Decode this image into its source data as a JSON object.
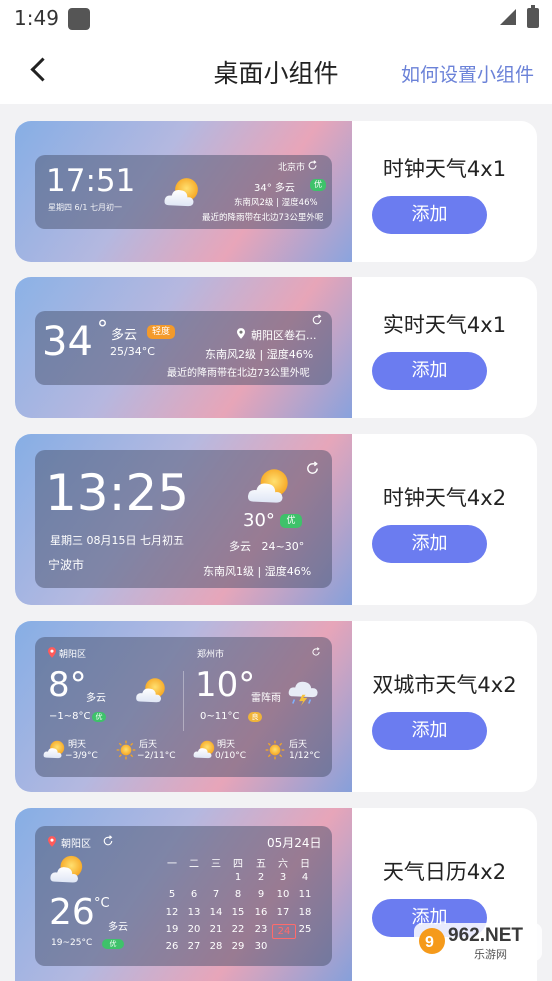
{
  "status": {
    "time": "1:49"
  },
  "header": {
    "title": "桌面小组件",
    "help_link": "如何设置小组件"
  },
  "add_label": "添加",
  "widgets": [
    {
      "name": "时钟天气4x1",
      "time": "17:51",
      "date": "星期四 6/1 七月初一",
      "city": "北京市",
      "temp_cond": "34° 多云",
      "aqi": "优",
      "wind_humidity": "东南风2级 | 湿度46%",
      "rain": "最近的降雨带在北边73公里外呢"
    },
    {
      "name": "实时天气4x1",
      "temp": "34",
      "deg": "°",
      "cond": "多云",
      "aqi": "轻度",
      "range": "25/34°C",
      "location": "朝阳区卷石...",
      "wind_humidity": "东南风2级 | 湿度46%",
      "rain": "最近的降雨带在北边73公里外呢"
    },
    {
      "name": "时钟天气4x2",
      "time": "13:25",
      "date": "星期三 08月15日 七月初五",
      "city": "宁波市",
      "temp": "30°",
      "aqi": "优",
      "cond_range": "多云   24~30°",
      "wind_humidity": "东南风1级 | 湿度46%"
    },
    {
      "name": "双城市天气4x2",
      "city1": "朝阳区",
      "city2": "郑州市",
      "c1_temp": "8°",
      "c1_cond": "多云",
      "c1_range": "−1~8°C",
      "c1_aqi": "优",
      "c2_temp": "10°",
      "c2_cond": "雷阵雨",
      "c2_range": "0~11°C",
      "c2_aqi": "良",
      "f1_label": "明天",
      "f1_range": "−3/9°C",
      "f2_label": "后天",
      "f2_range": "−2/11°C",
      "f3_label": "明天",
      "f3_range": "0/10°C",
      "f4_label": "后天",
      "f4_range": "1/12°C"
    },
    {
      "name": "天气日历4x2",
      "city": "朝阳区",
      "date": "05月24日",
      "temp": "26",
      "unit": "°C",
      "cond": "多云",
      "range": "19~25°C",
      "aqi": "优",
      "weekdays": [
        "一",
        "二",
        "三",
        "四",
        "五",
        "六",
        "日"
      ],
      "days": [
        "1",
        "2",
        "3",
        "4",
        "5",
        "6",
        "7",
        "8",
        "9",
        "10",
        "11",
        "12",
        "13",
        "14",
        "15",
        "16",
        "17",
        "18",
        "19",
        "20",
        "21",
        "22",
        "23",
        "24",
        "25",
        "26",
        "27",
        "28",
        "29",
        "30"
      ]
    }
  ],
  "watermark": {
    "text": "962.NET",
    "sub": "乐游网"
  }
}
